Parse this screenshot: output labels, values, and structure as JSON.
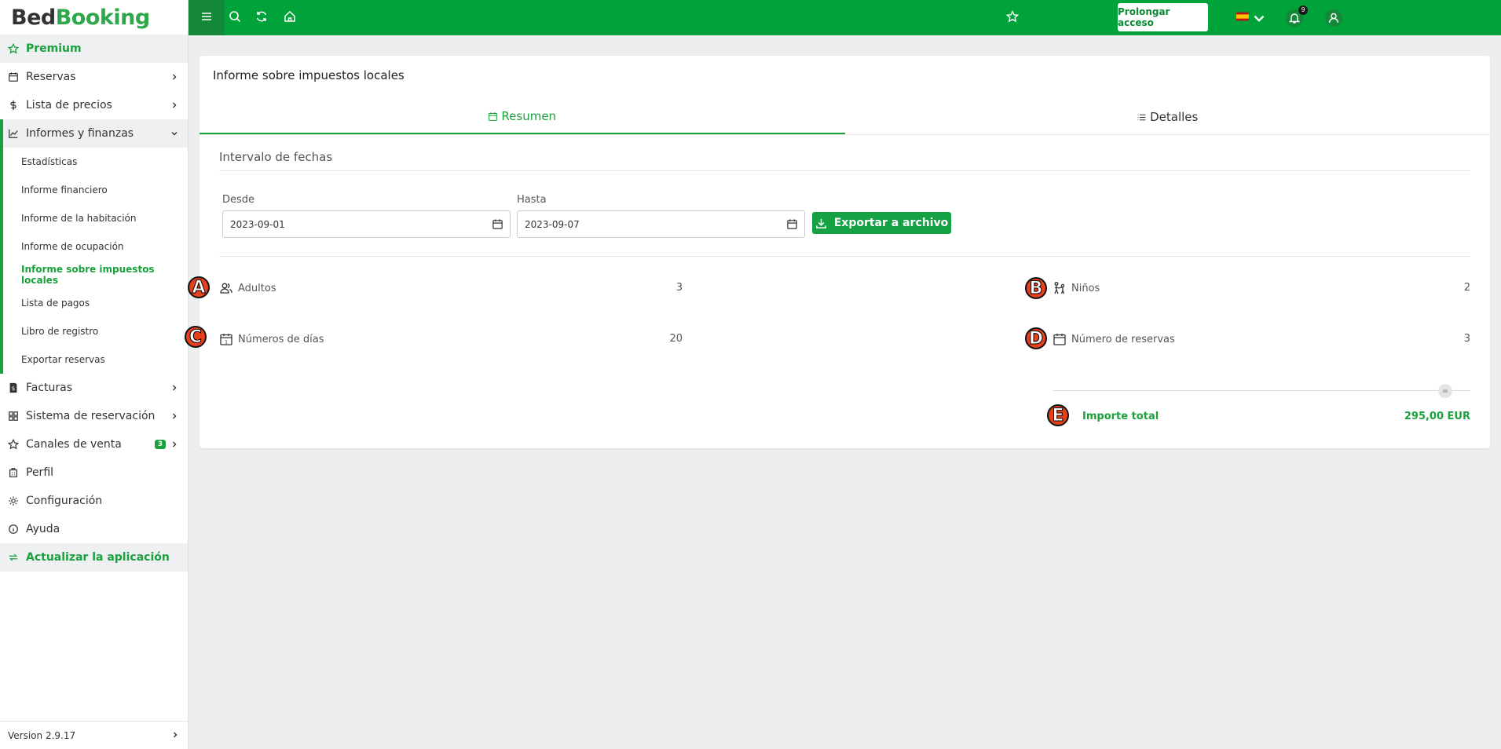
{
  "app": {
    "logo_part1": "Bed",
    "logo_part2": "Booking"
  },
  "colors": {
    "brand": "#00a23a",
    "accent": "#1aa13d",
    "marker": "#e6401c"
  },
  "sidebar": {
    "premium": "Premium",
    "items": [
      {
        "label": "Reservas",
        "icon": "calendar-icon"
      },
      {
        "label": "Lista de precios",
        "icon": "dollar-icon"
      },
      {
        "label": "Informes y finanzas",
        "icon": "chart-icon"
      }
    ],
    "sub_items": [
      "Estadísticas",
      "Informe financiero",
      "Informe de la habitación",
      "Informe de ocupación",
      "Informe sobre impuestos locales",
      "Lista de pagos",
      "Libro de registro",
      "Exportar reservas"
    ],
    "items_after": [
      {
        "label": "Facturas",
        "icon": "invoice-icon"
      },
      {
        "label": "Sistema de reservación",
        "icon": "grid-icon"
      },
      {
        "label": "Canales de venta",
        "icon": "star-icon",
        "badge": "3"
      },
      {
        "label": "Perfil",
        "icon": "building-icon"
      },
      {
        "label": "Configuración",
        "icon": "gear-icon"
      },
      {
        "label": "Ayuda",
        "icon": "info-icon"
      }
    ],
    "update": "Actualizar la aplicación",
    "version": "Version 2.9.17"
  },
  "topbar": {
    "prolong": "Prolongar acceso",
    "notifications": "9"
  },
  "report": {
    "title": "Informe sobre impuestos locales",
    "tabs": {
      "summary": "Resumen",
      "details": "Detalles"
    },
    "section": "Intervalo de fechas",
    "from_label": "Desde",
    "from_value": "2023-09-01",
    "to_label": "Hasta",
    "to_value": "2023-09-07",
    "export": "Exportar a archivo",
    "stats": {
      "adults_label": "Adultos",
      "adults_value": "3",
      "children_label": "Niños",
      "children_value": "2",
      "days_label": "Números de días",
      "days_value": "20",
      "bookings_label": "Número de reservas",
      "bookings_value": "3"
    },
    "total_label": "Importe total",
    "total_value": "295,00 EUR",
    "equals": "="
  },
  "markers": {
    "a": "A",
    "b": "B",
    "c": "C",
    "d": "D",
    "e": "E"
  }
}
